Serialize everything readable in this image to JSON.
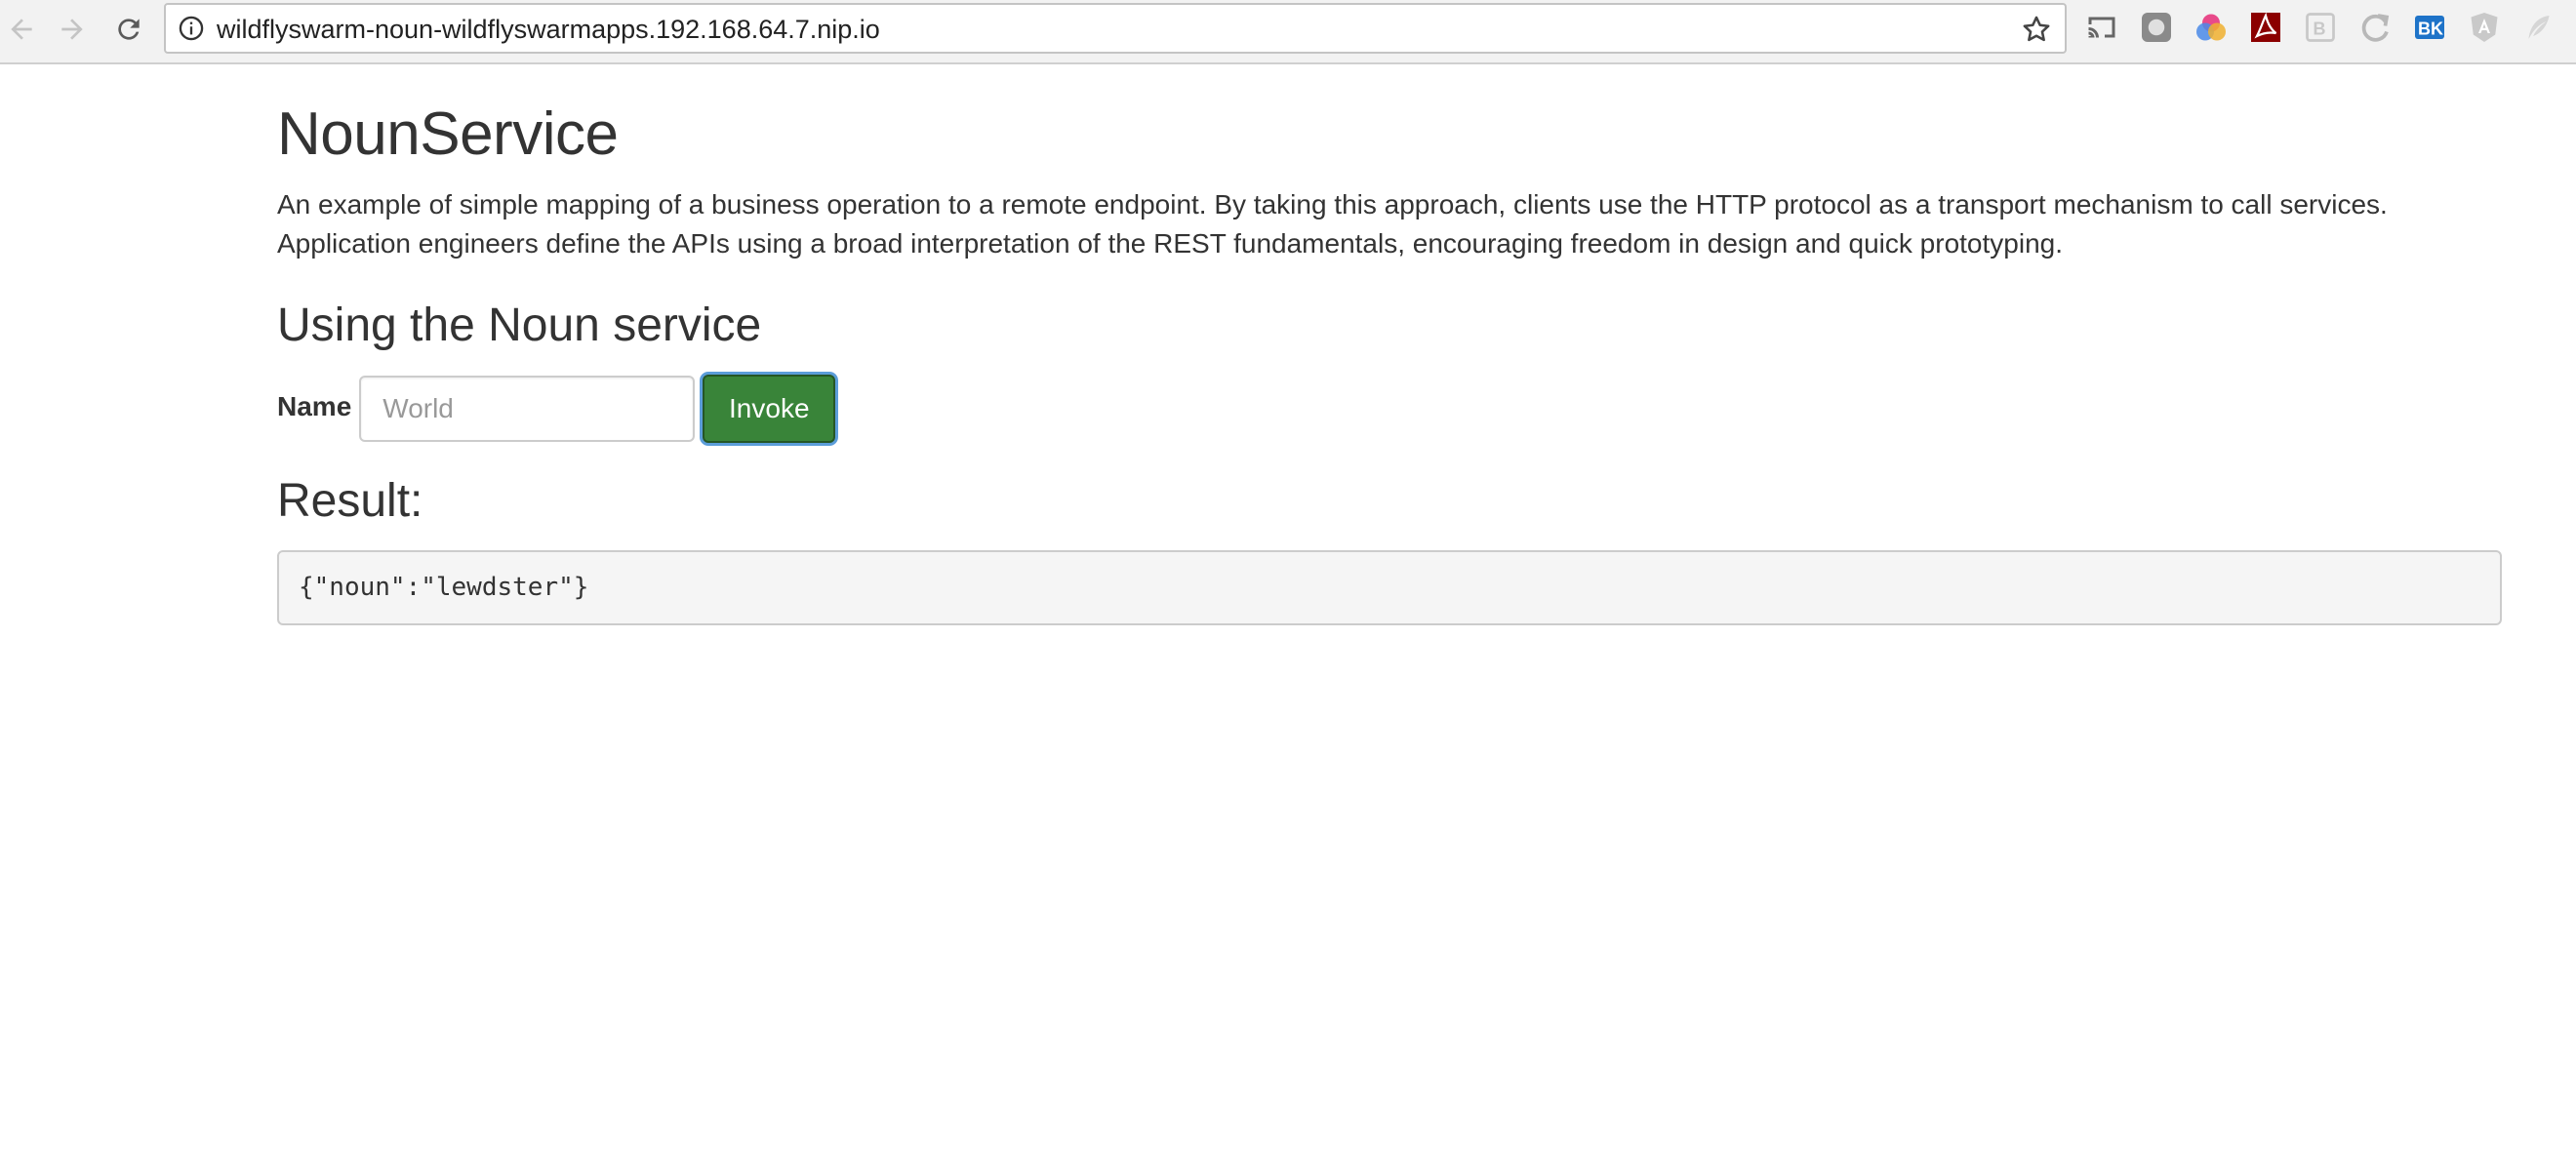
{
  "browser": {
    "url": "wildflyswarm-noun-wildflyswarmapps.192.168.64.7.nip.io"
  },
  "page": {
    "title": "NounService",
    "description": "An example of simple mapping of a business operation to a remote endpoint. By taking this approach, clients use the HTTP protocol as a transport mechanism to call services. Application engineers define the APIs using a broad interpretation of the REST fundamentals, encouraging freedom in design and quick prototyping.",
    "section_heading": "Using the Noun service",
    "form": {
      "name_label": "Name",
      "name_placeholder": "World",
      "name_value": "",
      "invoke_label": "Invoke"
    },
    "result_heading": "Result:",
    "result_text": "{\"noun\":\"lewdster\"}"
  },
  "colors": {
    "invoke_button": "#398439",
    "focus_ring": "#5b9dd9",
    "result_background": "#f5f5f5"
  },
  "icons": [
    "back-arrow-icon",
    "forward-arrow-icon",
    "reload-icon",
    "info-icon",
    "star-icon",
    "cast-icon",
    "extension-icons"
  ]
}
